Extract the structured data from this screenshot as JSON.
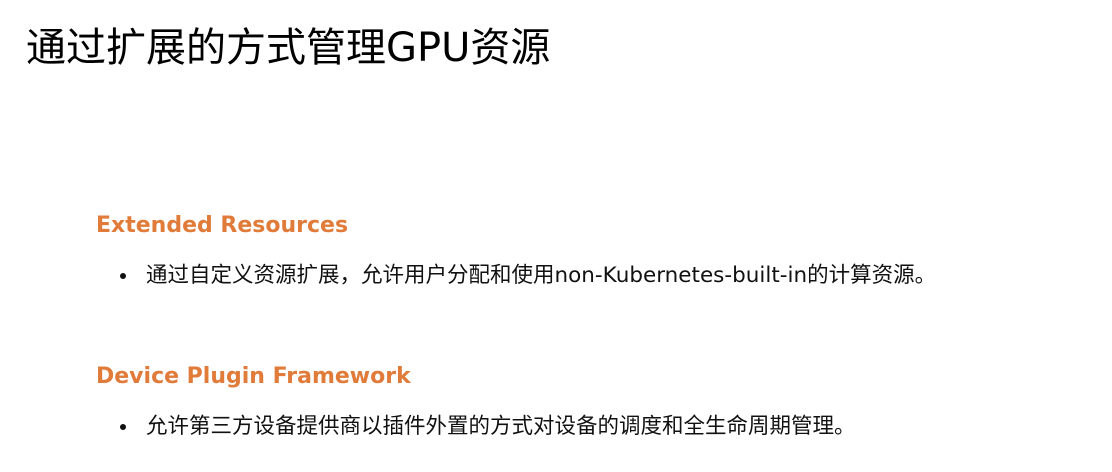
{
  "slide": {
    "title": "通过扩展的方式管理GPU资源",
    "accent_color": "#e07b39",
    "sections": [
      {
        "heading": "Extended Resources",
        "bullet": "通过自定义资源扩展，允许用户分配和使用non-Kubernetes-built-in的计算资源。"
      },
      {
        "heading": "Device Plugin Framework",
        "bullet": "允许第三方设备提供商以插件外置的方式对设备的调度和全生命周期管理。"
      }
    ]
  }
}
